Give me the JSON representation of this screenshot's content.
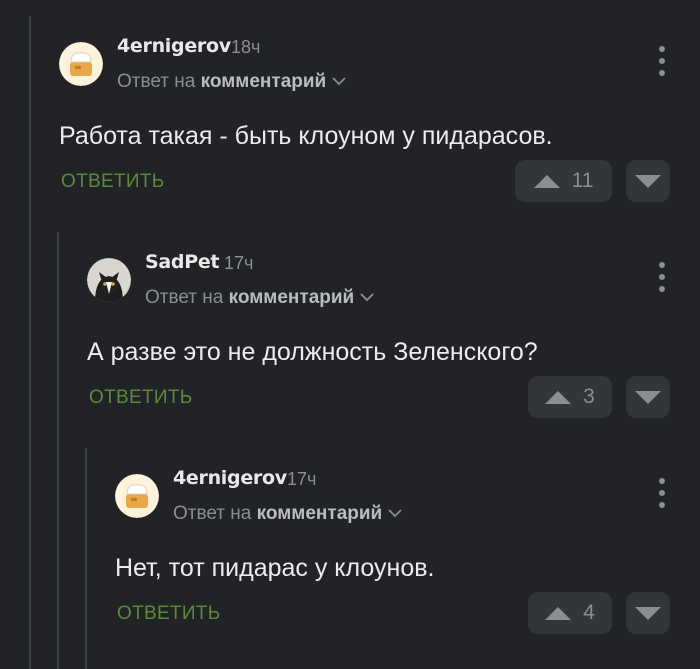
{
  "reply_to_prefix": "Ответ на",
  "reply_to_target": "комментарий",
  "reply_label": "ОТВЕТИТЬ",
  "comments": [
    {
      "author": "4ernigerov",
      "time": "18ч",
      "text": "Работа такая - быть клоуном у пидарасов.",
      "votes": "11",
      "avatar_icon": "cook-hat-avatar-icon"
    },
    {
      "author": "SadPet",
      "time": "17ч",
      "text": "А разве это не должность Зеленского?",
      "votes": "3",
      "avatar_icon": "cat-avatar-icon"
    },
    {
      "author": "4ernigerov",
      "time": "17ч",
      "text": "Нет, тот пидарас у клоунов.",
      "votes": "4",
      "avatar_icon": "cook-hat-avatar-icon"
    }
  ],
  "colors": {
    "background": "#212327",
    "reply_green": "#5b8a3a",
    "muted": "#8b8e93"
  }
}
